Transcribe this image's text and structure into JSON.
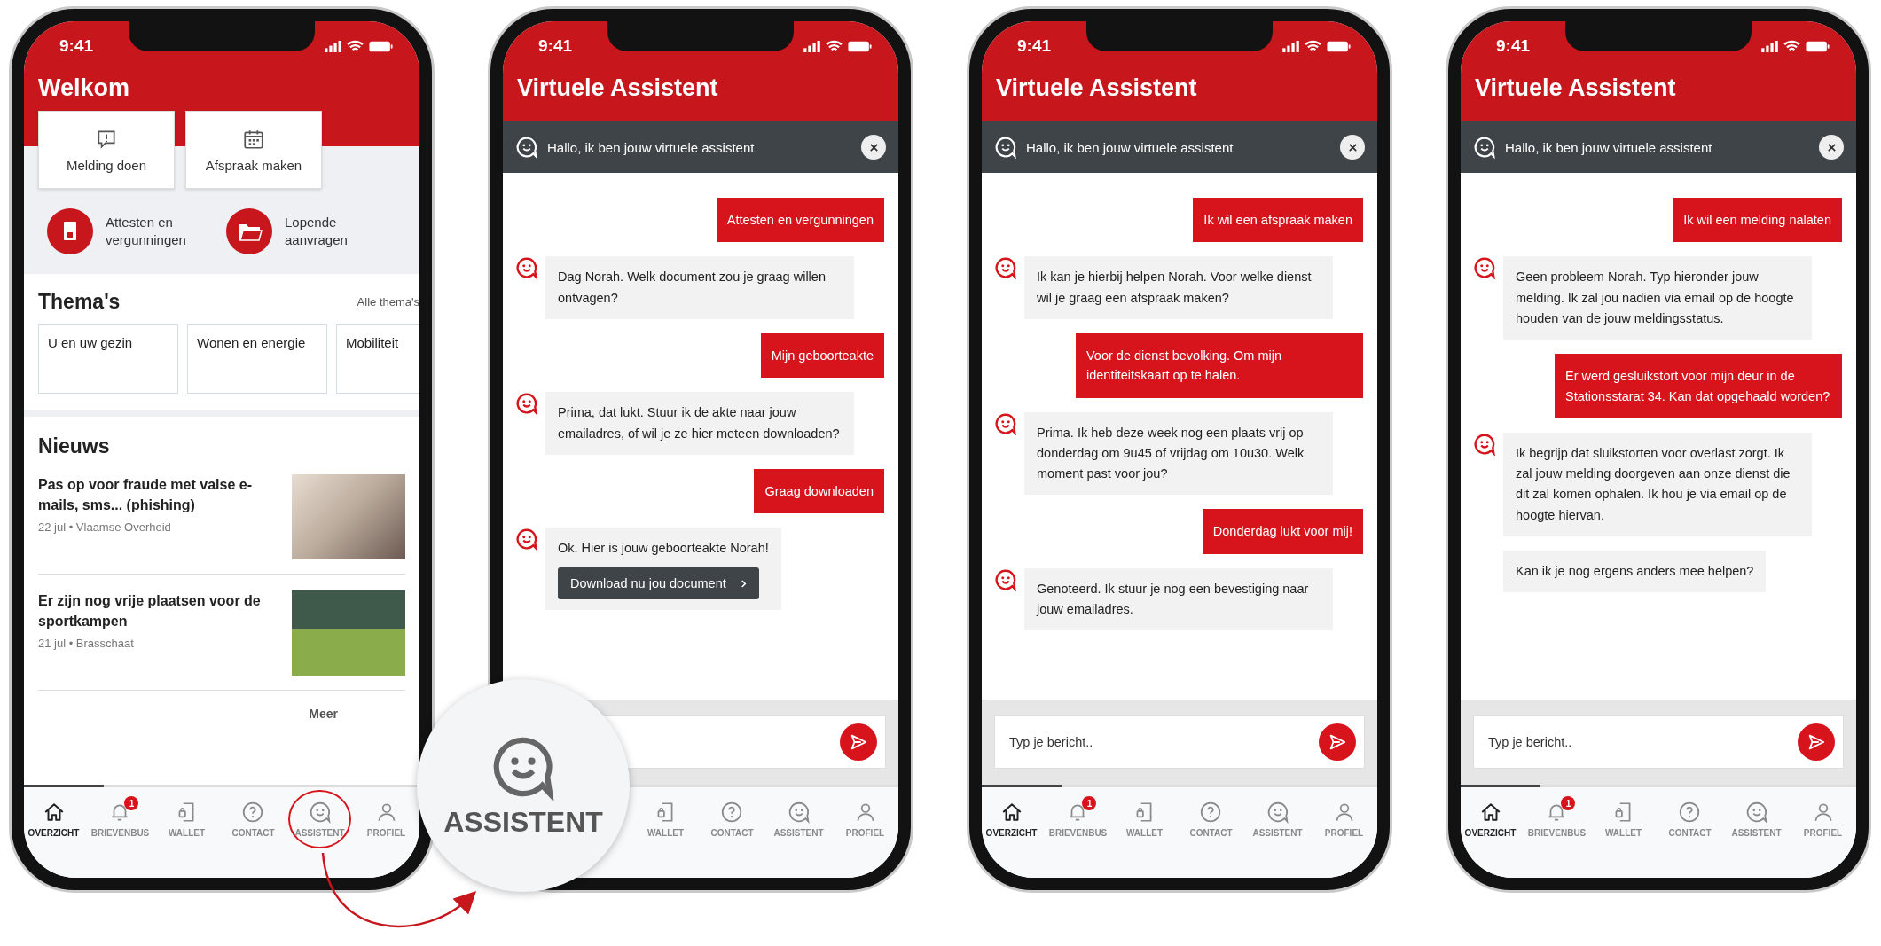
{
  "phones": [
    {
      "kind": "home",
      "time": "9:41",
      "title": "Welkom",
      "quick_actions": [
        "Melding doen",
        "Afspraak maken"
      ],
      "shortcuts": [
        "Attesten en vergunningen",
        "Lopende aanvragen"
      ],
      "themes": {
        "title": "Thema's",
        "link": "Alle thema's",
        "items": [
          "U en uw gezin",
          "Wonen en energie",
          "Mobiliteit"
        ]
      },
      "news": {
        "title": "Nieuws",
        "items": [
          {
            "headline": "Pas op voor fraude met valse e-mails, sms... (phishing)",
            "meta": "22 jul • Vlaamse Overheid"
          },
          {
            "headline": "Er zijn nog  vrije plaatsen voor de sportkampen",
            "meta": "21 jul • Brasschaat"
          }
        ],
        "more": "Meer"
      },
      "nav": [
        {
          "label": "OVERZICHT",
          "selected": true,
          "circled": false
        },
        {
          "label": "BRIEVENBUS",
          "selected": false,
          "circled": false,
          "badge": "1"
        },
        {
          "label": "WALLET",
          "selected": false,
          "circled": false
        },
        {
          "label": "CONTACT",
          "selected": false,
          "circled": false
        },
        {
          "label": "ASSISTENT",
          "selected": false,
          "circled": true
        },
        {
          "label": "PROFIEL",
          "selected": false,
          "circled": false
        }
      ]
    },
    {
      "kind": "chat",
      "time": "9:41",
      "title": "Virtuele Assistent",
      "banner": "Hallo, ik ben jouw virtuele assistent",
      "messages": [
        {
          "kind": "user",
          "text": "Attesten en vergunningen"
        },
        {
          "kind": "bot",
          "avatar": true,
          "text": "Dag Norah. Welk document zou je graag willen ontvagen?"
        },
        {
          "kind": "user",
          "text": "Mijn geboorteakte"
        },
        {
          "kind": "bot",
          "avatar": true,
          "text": "Prima, dat lukt. Stuur ik de akte naar jouw emailadres, of wil je ze hier meteen downloaden?"
        },
        {
          "kind": "user",
          "text": "Graag downloaden"
        },
        {
          "kind": "bot",
          "avatar": true,
          "text": "Ok. Hier is jouw geboorteakte Norah!",
          "action": "Download nu jou document"
        }
      ],
      "nav": [
        {
          "label": "WALLET",
          "selected": false
        },
        {
          "label": "CONTACT",
          "selected": false
        },
        {
          "label": "ASSISTENT",
          "selected": false
        },
        {
          "label": "PROFIEL",
          "selected": false
        }
      ]
    },
    {
      "kind": "chat",
      "time": "9:41",
      "title": "Virtuele Assistent",
      "banner": "Hallo, ik ben jouw virtuele assistent",
      "messages": [
        {
          "kind": "user",
          "text": "Ik wil een afspraak maken"
        },
        {
          "kind": "bot",
          "avatar": true,
          "text": "Ik kan je hierbij helpen Norah. Voor welke dienst wil je graag een afspraak maken?"
        },
        {
          "kind": "user",
          "text": "Voor de dienst bevolking. Om mijn identiteitskaart op te halen."
        },
        {
          "kind": "bot",
          "avatar": true,
          "text": "Prima. Ik heb deze week nog een plaats vrij op donderdag om 9u45 of vrijdag om 10u30. Welk moment past voor jou?"
        },
        {
          "kind": "user",
          "text": "Donderdag lukt voor mij!"
        },
        {
          "kind": "bot",
          "avatar": true,
          "text": "Genoteerd. Ik stuur je nog een bevestiging naar jouw emailadres."
        }
      ],
      "placeholder": "Typ je bericht..",
      "nav": [
        {
          "label": "OVERZICHT",
          "selected": true
        },
        {
          "label": "BRIEVENBUS",
          "selected": false,
          "badge": "1"
        },
        {
          "label": "WALLET",
          "selected": false
        },
        {
          "label": "CONTACT",
          "selected": false
        },
        {
          "label": "ASSISTENT",
          "selected": false
        },
        {
          "label": "PROFIEL",
          "selected": false
        }
      ]
    },
    {
      "kind": "chat",
      "time": "9:41",
      "title": "Virtuele Assistent",
      "banner": "Hallo, ik ben jouw virtuele assistent",
      "messages": [
        {
          "kind": "user",
          "text": "Ik wil een melding nalaten"
        },
        {
          "kind": "bot",
          "avatar": true,
          "text": "Geen probleem Norah. Typ hieronder jouw melding. Ik zal jou nadien via email op de hoogte houden van de jouw meldingsstatus."
        },
        {
          "kind": "user",
          "text": "Er werd gesluikstort voor mijn deur in de Stationsstarat 34. Kan dat opgehaald worden?"
        },
        {
          "kind": "bot",
          "avatar": true,
          "text": "Ik begrijp dat sluikstorten voor overlast zorgt. Ik zal jouw melding doorgeven aan onze dienst die dit zal komen ophalen. Ik hou je via email op de hoogte hiervan."
        },
        {
          "kind": "bot",
          "avatar": false,
          "text": "Kan ik je nog ergens anders mee helpen?"
        }
      ],
      "placeholder": "Typ je bericht..",
      "nav": [
        {
          "label": "OVERZICHT",
          "selected": true
        },
        {
          "label": "BRIEVENBUS",
          "selected": false,
          "badge": "1"
        },
        {
          "label": "WALLET",
          "selected": false
        },
        {
          "label": "CONTACT",
          "selected": false
        },
        {
          "label": "ASSISTENT",
          "selected": false
        },
        {
          "label": "PROFIEL",
          "selected": false
        }
      ]
    }
  ],
  "magnifier": {
    "label": "ASSISTENT"
  }
}
